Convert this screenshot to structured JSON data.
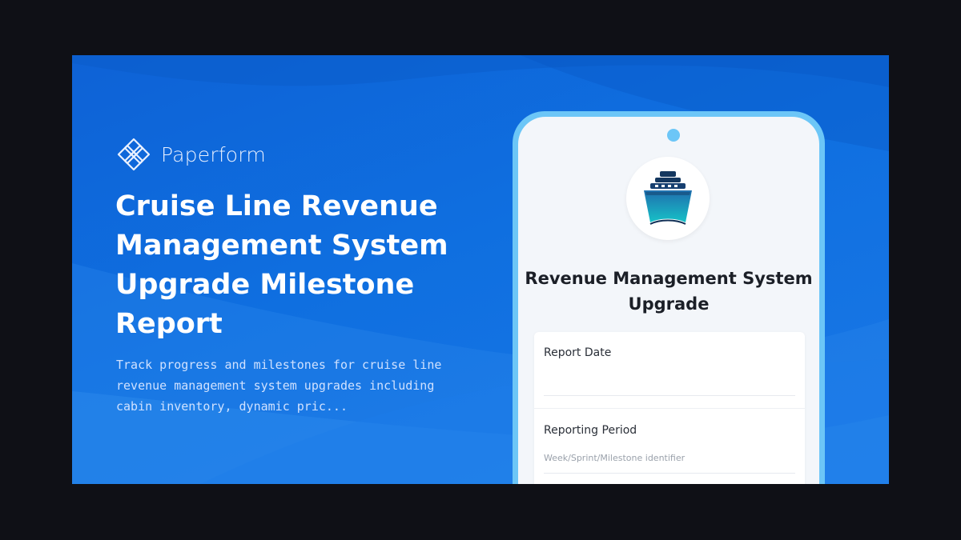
{
  "brand": {
    "name": "Paperform",
    "logo_icon": "paperform-logo-icon"
  },
  "headline": "Cruise Line Revenue Management System Upgrade Milestone Report",
  "description": "Track progress and milestones for cruise line revenue management system upgrades including cabin inventory, dynamic pric...",
  "phone": {
    "logo_icon": "cruise-ship-icon",
    "form_title": "Revenue Management System Upgrade",
    "fields": [
      {
        "label": "Report Date",
        "placeholder": ""
      },
      {
        "label": "Reporting Period",
        "placeholder": "Week/Sprint/Milestone identifier"
      }
    ]
  },
  "colors": {
    "page_background": "#0f1016",
    "banner_blue": "#0f6fe0",
    "phone_frame": "#6cc6f7",
    "screen_background": "#f3f6fa"
  }
}
